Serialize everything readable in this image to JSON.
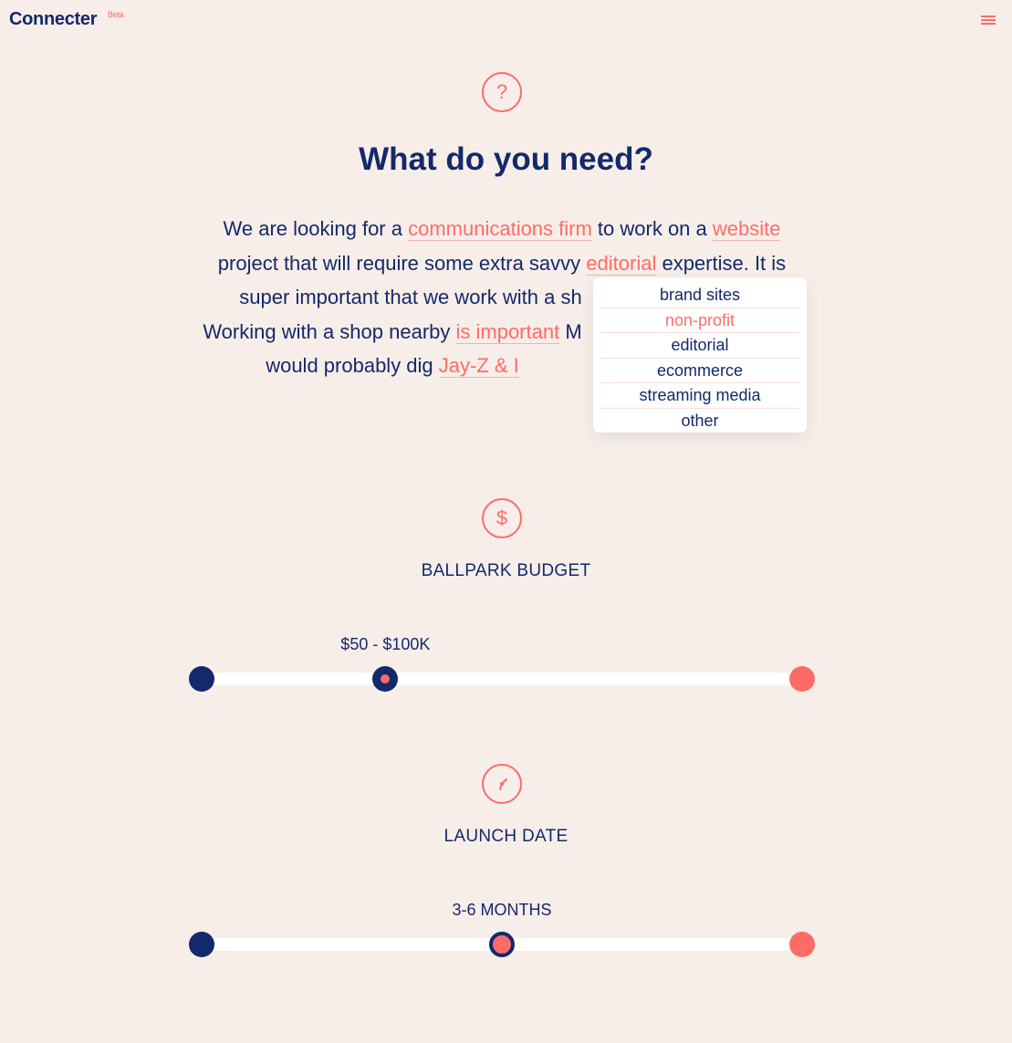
{
  "header": {
    "logo": "Connecter",
    "badge": "Beta",
    "menu_icon": "hamburger-menu-icon"
  },
  "question": {
    "icon": "question-icon",
    "icon_glyph": "?",
    "title": "What do you need?"
  },
  "paragraph": {
    "l1_a": "We are looking for a ",
    "firm_type": "communications firm",
    "l1_b": " to work on a ",
    "project_type": "website",
    "l2_a": "project that will require some extra savvy ",
    "expertise": "editorial",
    "l2_b": " expertise. It is",
    "l3_a": "super important that we work with a sh",
    "l4_a": "Working with a shop nearby ",
    "location_importance": "is important",
    "l4_b": " M",
    "l5_a": "would probably dig ",
    "reference": "Jay-Z & I"
  },
  "dropdown": {
    "options": [
      "brand sites",
      "non-profit",
      "editorial",
      "ecommerce",
      "streaming media",
      "other"
    ],
    "highlighted": "non-profit"
  },
  "budget": {
    "icon": "dollar-icon",
    "icon_glyph": "$",
    "label": "BALLPARK BUDGET",
    "value": "$50 - $100K",
    "position_fraction": 0.306
  },
  "launch": {
    "icon": "clock-icon",
    "label": "LAUNCH DATE",
    "value": "3-6 MONTHS",
    "position_fraction": 0.5
  },
  "colors": {
    "background": "#f7eee9",
    "navy": "#13296b",
    "coral": "#ff6b66"
  }
}
